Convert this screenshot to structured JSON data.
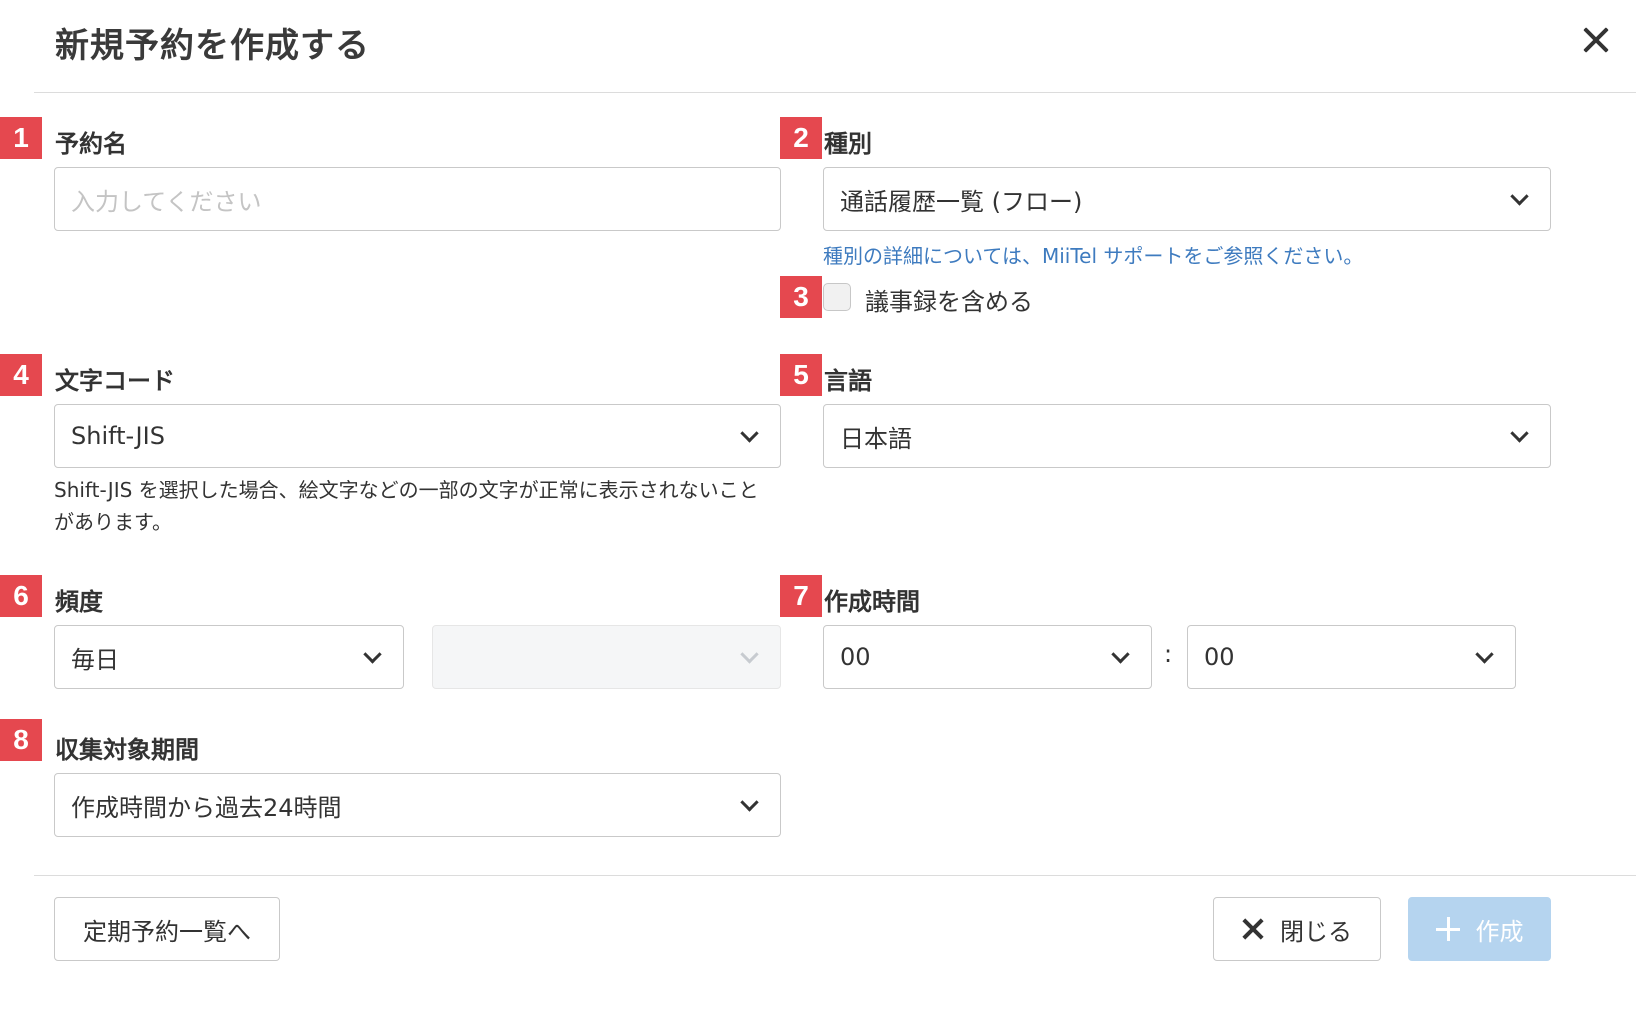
{
  "dialog": {
    "title": "新規予約を作成する"
  },
  "fields": {
    "name": {
      "badge": "1",
      "label": "予約名",
      "placeholder": "入力してください"
    },
    "type": {
      "badge": "2",
      "label": "種別",
      "value": "通話履歴一覧 (フロー)",
      "help_link": "種別の詳細については、MiiTel サポートをご参照ください。"
    },
    "minutes": {
      "badge": "3",
      "label": "議事録を含める",
      "checked": false
    },
    "encoding": {
      "badge": "4",
      "label": "文字コード",
      "value": "Shift-JIS",
      "help_line1": "Shift-JIS を選択した場合、絵文字などの一部の文字が正常に表示されないこと",
      "help_line2": "があります。"
    },
    "language": {
      "badge": "5",
      "label": "言語",
      "value": "日本語"
    },
    "frequency": {
      "badge": "6",
      "label": "頻度",
      "value": "毎日",
      "secondary_value": ""
    },
    "time": {
      "badge": "7",
      "label": "作成時間",
      "hour": "00",
      "separator": ":",
      "minute": "00"
    },
    "period": {
      "badge": "8",
      "label": "収集対象期間",
      "value": "作成時間から過去24時間"
    }
  },
  "footer": {
    "list_button": "定期予約一覧へ",
    "close_button": "閉じる",
    "create_button": "作成"
  },
  "colors": {
    "badge": "#e5484f",
    "link": "#3e7bbf",
    "primary_disabled": "#b5d4ef"
  }
}
